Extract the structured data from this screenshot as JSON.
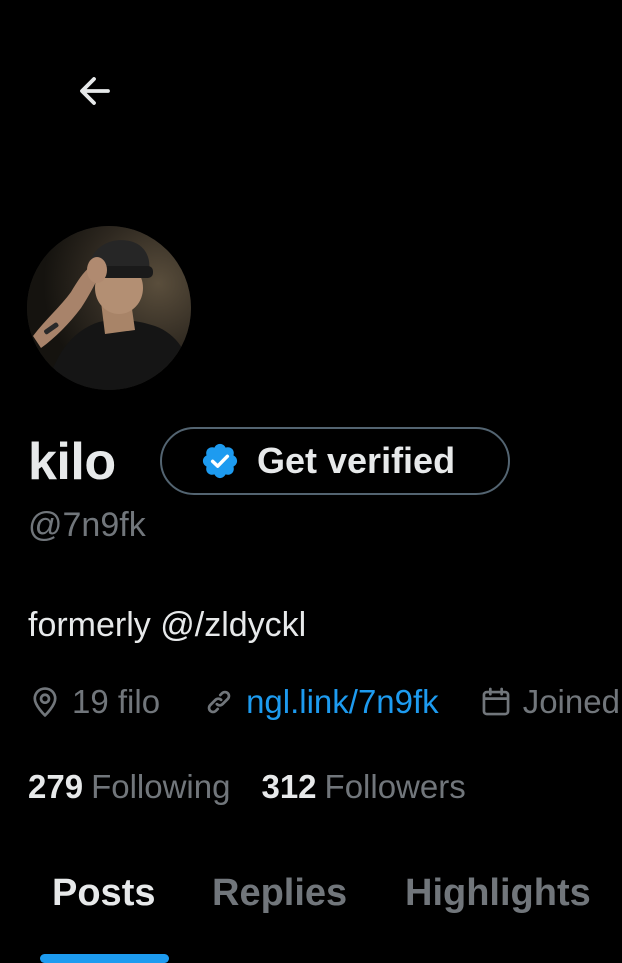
{
  "colors": {
    "background": "#000000",
    "text_primary": "#e7e9ea",
    "text_secondary": "#71767b",
    "accent": "#1d9bf0",
    "border": "#536471"
  },
  "header": {
    "back_icon": "arrow-left-icon"
  },
  "profile": {
    "avatar_icon": "profile-photo",
    "display_name": "kilo",
    "verify_button": {
      "icon": "verified-badge-icon",
      "label": "Get verified"
    },
    "handle": "@7n9fk",
    "bio": "formerly @/zldyckl",
    "meta": {
      "location_icon": "location-pin-icon",
      "location": "19 filo",
      "link_icon": "link-icon",
      "link": "ngl.link/7n9fk",
      "joined_icon": "calendar-icon",
      "joined": "Joined"
    },
    "following": {
      "count": "279",
      "label": "Following"
    },
    "followers": {
      "count": "312",
      "label": "Followers"
    }
  },
  "tabs": {
    "items": [
      {
        "label": "Posts",
        "active": true
      },
      {
        "label": "Replies",
        "active": false
      },
      {
        "label": "Highlights",
        "active": false
      }
    ]
  }
}
